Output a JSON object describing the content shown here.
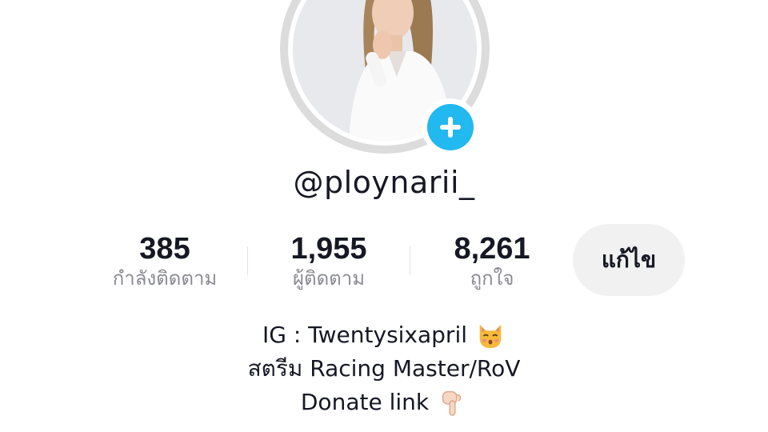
{
  "profile": {
    "username": "@ploynarii_",
    "avatar_icon": "profile-photo",
    "add_icon": "plus-icon"
  },
  "stats": {
    "following": {
      "value": "385",
      "label": "กำลังติดตาม"
    },
    "followers": {
      "value": "1,955",
      "label": "ผู้ติดตาม"
    },
    "likes": {
      "value": "8,261",
      "label": "ถูกใจ"
    }
  },
  "actions": {
    "edit_label": "แก้ไข"
  },
  "bio": {
    "line1": "IG : Twentysixapril",
    "line1_emoji": "kissing-cat-emoji",
    "line2": "สตรีม Racing Master/RoV",
    "line3": "Donate link",
    "line3_emoji": "pointing-down-emoji"
  },
  "colors": {
    "accent": "#22b8f0",
    "text": "#161823",
    "secondary_text": "#8a8b91",
    "button_bg": "#f1f1f2"
  }
}
